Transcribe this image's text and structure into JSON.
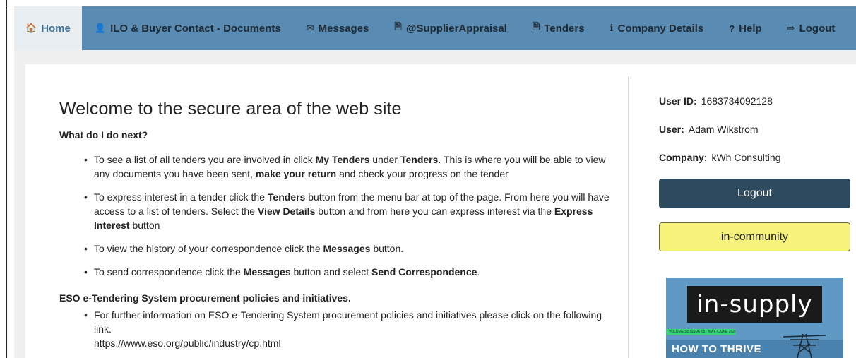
{
  "nav": {
    "items": [
      {
        "label": "Home",
        "icon": "home-icon",
        "glyph": "🏠",
        "active": true
      },
      {
        "label": "ILO & Buyer Contact - Documents",
        "icon": "user-icon",
        "glyph": "👤",
        "active": false
      },
      {
        "label": "Messages",
        "icon": "envelope-icon",
        "glyph": "✉",
        "active": false
      },
      {
        "label": "@SupplierAppraisal",
        "icon": "document-icon",
        "glyph": "🗎",
        "active": false
      },
      {
        "label": "Tenders",
        "icon": "document-icon",
        "glyph": "🗎",
        "active": false
      },
      {
        "label": "Company Details",
        "icon": "info-icon",
        "glyph": "ℹ",
        "active": false
      },
      {
        "label": "Help",
        "icon": "question-icon",
        "glyph": "?",
        "active": false
      },
      {
        "label": "Logout",
        "icon": "sign-out-icon",
        "glyph": "⇨",
        "active": false
      }
    ]
  },
  "main": {
    "title": "Welcome to the secure area of the web site",
    "subhead": "What do I do next?",
    "tips": [
      {
        "parts": [
          "To see a list of all tenders you are involved in click ",
          "My Tenders",
          " under ",
          "Tenders",
          ". This is where you will be able to view any documents you have been sent, ",
          "make your return",
          " and check your progress on the tender"
        ]
      },
      {
        "parts": [
          "To express interest in a tender click the ",
          "Tenders",
          " button from the menu bar at top of the page. From here you will have access to a list of tenders. Select the ",
          "View Details",
          " button and from here you can express interest via the ",
          "Express Interest",
          " button"
        ]
      },
      {
        "parts": [
          "To view the history of your correspondence click the ",
          "Messages",
          " button."
        ]
      },
      {
        "parts": [
          "To send correspondence click the ",
          "Messages",
          " button and select ",
          "Send Correspondence",
          "."
        ]
      }
    ],
    "policy_heading": "ESO e-Tendering System procurement policies and initiatives.",
    "policy_text": "For further information on ESO e-Tendering System procurement policies and initiatives please click on the following link.",
    "policy_link": "https://www.eso.org/public/industry/cp.html"
  },
  "sidebar": {
    "user_id_label": "User ID:",
    "user_id": "1683734092128",
    "user_label": "User:",
    "user": "Adam Wikstrom",
    "company_label": "Company:",
    "company": "kWh Consulting",
    "logout_button": "Logout",
    "community_button": "in-community",
    "promo": {
      "logo_text": "in-supply",
      "strip_text": "VOLUME 58 ISSUE 05 · MAY / JUNE 2020",
      "headline": "HOW TO THRIVE"
    }
  },
  "colors": {
    "navbar": "#5a8cb3",
    "logout_button": "#2e4a5f",
    "community_button": "#f6f27a"
  }
}
